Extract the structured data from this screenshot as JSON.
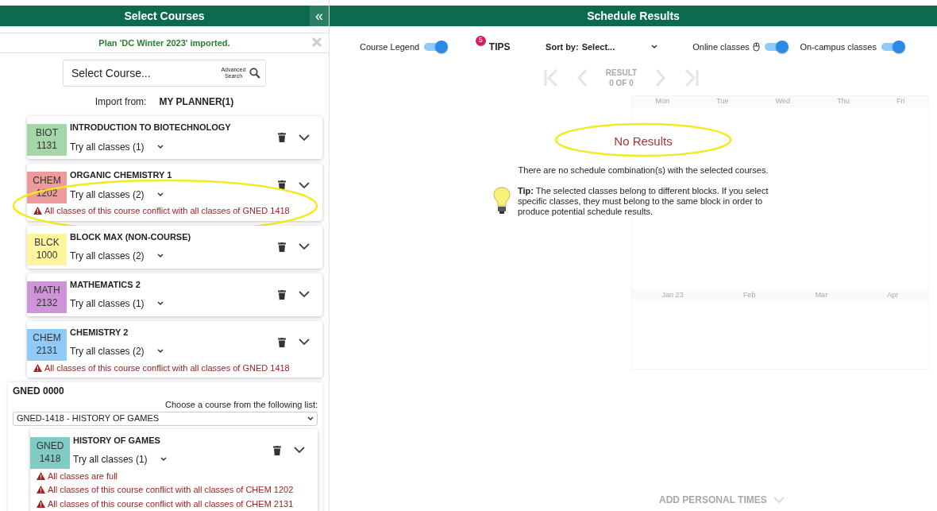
{
  "left_panel": {
    "title": "Select Courses",
    "collapse_icon": "«",
    "notice": "Plan 'DC Winter 2023' imported.",
    "search": {
      "placeholder": "Select Course...",
      "advanced": "Advanced Search"
    },
    "import": {
      "label": "Import from:",
      "source": "MY PLANNER(1)"
    },
    "courses": [
      {
        "subject": "BIOT",
        "number": "1131",
        "title": "INTRODUCTION TO BIOTECHNOLOGY",
        "classes": "Try all classes (1)",
        "color": "#a5d6a7"
      },
      {
        "subject": "CHEM",
        "number": "1202",
        "title": "ORGANIC CHEMISTRY 1",
        "classes": "Try all classes (2)",
        "color": "#ef9a9a",
        "highlighted": true,
        "warnings": [
          "All classes of this course conflict with all classes of GNED 1418"
        ]
      },
      {
        "subject": "BLCK",
        "number": "1000",
        "title": "BLOCK MAX (NON-COURSE)",
        "classes": "Try all classes (2)",
        "color": "#fff59d"
      },
      {
        "subject": "MATH",
        "number": "2132",
        "title": "MATHEMATICS 2",
        "classes": "Try all classes (1)",
        "color": "#ce93d8"
      },
      {
        "subject": "CHEM",
        "number": "2131",
        "title": "CHEMISTRY 2",
        "classes": "Try all classes (2)",
        "color": "#90caf9",
        "warnings": [
          "All classes of this course conflict with all classes of GNED 1418"
        ]
      }
    ],
    "group": {
      "title": "GNED 0000",
      "hint": "Choose a course from the following list:",
      "choice": "GNED-1418 - HISTORY OF GAMES",
      "course": {
        "subject": "GNED",
        "number": "1418",
        "title": "HISTORY OF GAMES",
        "classes": "Try all classes (1)",
        "color": "#80cbc4",
        "warnings": [
          "All classes are full",
          "All classes of this course conflict with all classes of CHEM 1202",
          "All classes of this course conflict with all classes of CHEM 2131"
        ]
      }
    }
  },
  "right_panel": {
    "title": "Schedule Results",
    "toolbar": [
      {
        "kind": "switch",
        "label": "Course Legend",
        "on": true
      },
      {
        "kind": "tips",
        "label": "TIPS",
        "badge": "5"
      },
      {
        "kind": "sort",
        "label": "Sort by:",
        "value": "Select..."
      },
      {
        "kind": "switch",
        "label": "Online classes",
        "on": true,
        "icon": true
      },
      {
        "kind": "switch",
        "label": "On-campus classes",
        "on": true
      }
    ],
    "pager": {
      "label": "RESULT",
      "count": "0 OF 0"
    },
    "calendar": {
      "days": [
        "Mon",
        "Tue",
        "Wed",
        "Thu",
        "Fri"
      ],
      "months": [
        "Jan 23",
        "Feb",
        "Mar",
        "Apr"
      ]
    },
    "message": {
      "title": "No Results",
      "highlighted": true,
      "text": "There are no schedule combination(s) with the selected courses.",
      "tip": "**Tip:** The selected classes belong to different blocks. If you select specific classes, they must belong to the same block in order to produce potential schedule results."
    },
    "personal_times": "ADD PERSONAL TIMES"
  }
}
